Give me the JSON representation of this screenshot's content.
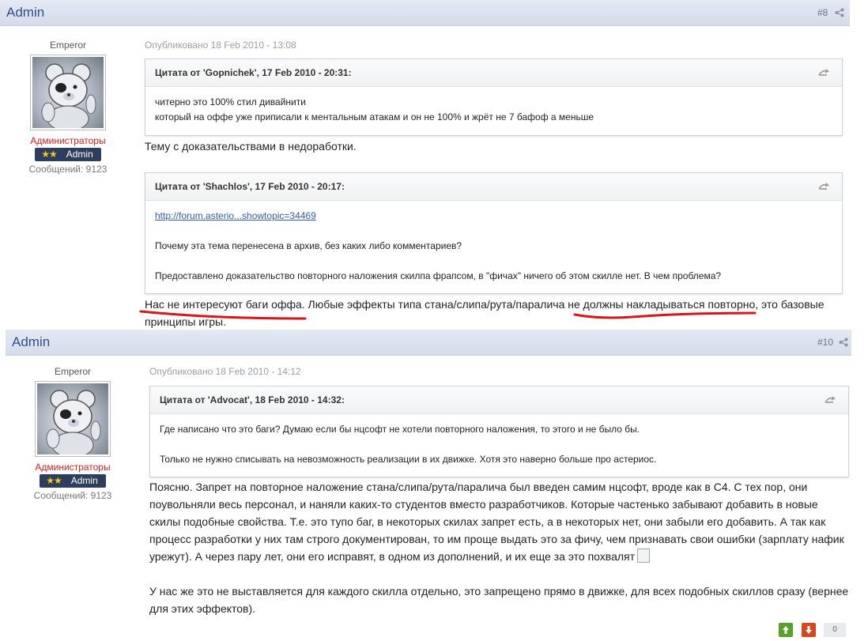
{
  "posts": [
    {
      "author": "Admin",
      "post_number": "#8",
      "rank": "Emperor",
      "group": "Администраторы",
      "badge": "Admin",
      "badge_stars": "★★",
      "message_count": "Сообщений: 9123",
      "published": "Опубликовано 18 Feb 2010 - 13:08",
      "quotes": [
        {
          "header": "Цитата от 'Gopnichek', 17 Feb 2010 - 20:31:",
          "lines": [
            "читерно это 100% стил дивайнити",
            "который на оффе уже приписали к ментальным атакам и он не 100% и жрёт не 7 бафоф а меньше"
          ]
        },
        {
          "header": "Цитата от 'Shachlos', 17 Feb 2010 - 20:17:",
          "link": "http://forum.asterio...showtopic=34469",
          "lines": [
            "Почему эта тема перенесена в архив, без каких либо комментариев?",
            "Предоставлено доказательство повторного наложения скилпа фрапсом, в \"фичах\" ничего об этом скилле нет. В чем проблема?"
          ]
        }
      ],
      "text_after_quote1": "Тему с доказательствами в недоработки.",
      "text_final": "Нас не интересуют баги оффа. Любые эффекты типа стана/слипа/рута/паралича не должны накладываться повторно, это базовые принципы игры."
    },
    {
      "author": "Admin",
      "post_number": "#10",
      "rank": "Emperor",
      "group": "Администраторы",
      "badge": "Admin",
      "badge_stars": "★★",
      "message_count": "Сообщений: 9123",
      "published": "Опубликовано 18 Feb 2010 - 14:12",
      "quotes": [
        {
          "header": "Цитата от 'Advocat', 18 Feb 2010 - 14:32:",
          "lines": [
            "Где написано что это баги? Думаю если бы нцсофт не хотели повторного наложения, то этого и не было бы.",
            "Только не нужно списывать на невозможность реализации в их движке. Хотя это наверно больше про астериос."
          ]
        }
      ],
      "text_para1": "Поясню. Запрет на повторное наложение стана/слипа/рута/паралича был введен самим нцсофт, вроде как в С4. С тех пор, они поувольняли весь персонал, и наняли каких-то студентов вместо разработчиков. Которые частенько забывают добавить в новые скилы подобные свойства. Т.е. это тупо баг, в некоторых скилах запрет есть, а в некоторых нет, они забыли его добавить. А так как процесс разработки у них там строго документирован, то им проще выдать это за фичу, чем признавать свои ошибки (зарплату нафик урежут). А через пару лет, они его исправят, в одном из дополнений, и их еще за это похвалят",
      "text_para2": "У нас же это не выставляется для каждого скилла отдельно, это запрещено прямо в движке, для всех подобных скиллов сразу (вернее для этих эффектов).",
      "vote_count": "0"
    }
  ],
  "colors": {
    "header_bg": "#d5dceb",
    "author": "#2e4f8c",
    "group": "#d01f1f",
    "badge_bg": "#2d3d5e",
    "vote_up": "#5aa02c",
    "vote_down": "#d4471f",
    "annotation": "#d9141b"
  }
}
